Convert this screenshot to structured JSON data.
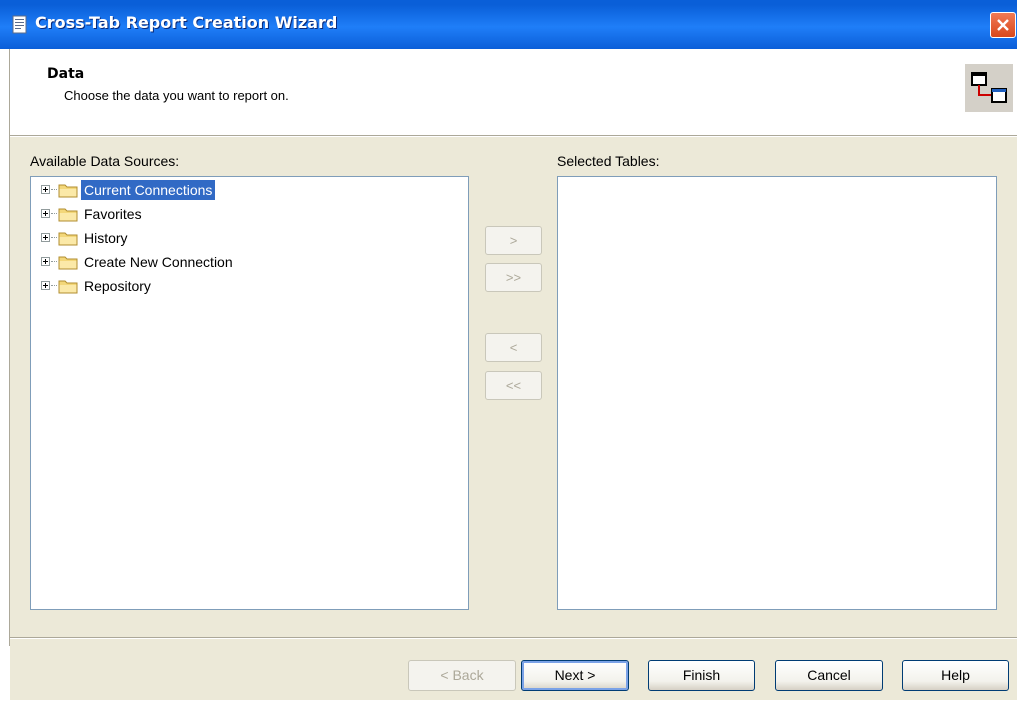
{
  "window": {
    "title": "Cross-Tab Report Creation Wizard",
    "close_icon": "close-icon"
  },
  "header": {
    "title": "Data",
    "subtitle": "Choose the data you want to report on.",
    "icon": "table-link-icon"
  },
  "available": {
    "label": "Available Data Sources:",
    "items": [
      {
        "label": "Current Connections",
        "selected": true
      },
      {
        "label": "Favorites"
      },
      {
        "label": "History"
      },
      {
        "label": "Create New Connection"
      },
      {
        "label": "Repository"
      }
    ]
  },
  "selected": {
    "label": "Selected Tables:"
  },
  "move_buttons": {
    "add": ">",
    "add_all": ">>",
    "remove": "<",
    "remove_all": "<<"
  },
  "footer": {
    "back": "< Back",
    "next": "Next >",
    "finish": "Finish",
    "cancel": "Cancel",
    "help": "Help"
  },
  "colors": {
    "titlebar": "#0a5fd8",
    "selection": "#316ac5",
    "dialog_bg": "#ece9d8"
  }
}
